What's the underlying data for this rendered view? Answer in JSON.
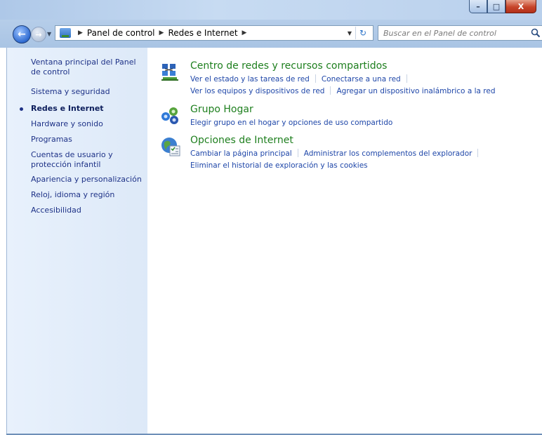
{
  "window": {
    "minimize": "–",
    "maximize": "□",
    "close": "X"
  },
  "address": {
    "crumbs": [
      "Panel de control",
      "Redes e Internet"
    ]
  },
  "search": {
    "placeholder": "Buscar en el Panel de control"
  },
  "sidebar": {
    "items": [
      {
        "label": "Ventana principal del Panel de control",
        "current": false
      },
      {
        "label": "Sistema y seguridad",
        "current": false
      },
      {
        "label": "Redes e Internet",
        "current": true
      },
      {
        "label": "Hardware y sonido",
        "current": false
      },
      {
        "label": "Programas",
        "current": false
      },
      {
        "label": "Cuentas de usuario y protección infantil",
        "current": false
      },
      {
        "label": "Apariencia y personalización",
        "current": false
      },
      {
        "label": "Reloj, idioma y región",
        "current": false
      },
      {
        "label": "Accesibilidad",
        "current": false
      }
    ]
  },
  "categories": [
    {
      "title": "Centro de redes y recursos compartidos",
      "icon": "network-center-icon",
      "links": [
        [
          "Ver el estado y las tareas de red",
          "Conectarse a una red"
        ],
        [
          "Ver los equipos y dispositivos de red",
          "Agregar un dispositivo inalámbrico a la red"
        ]
      ]
    },
    {
      "title": "Grupo Hogar",
      "icon": "homegroup-icon",
      "links": [
        [
          "Elegir grupo en el hogar y opciones de uso compartido"
        ]
      ]
    },
    {
      "title": "Opciones de Internet",
      "icon": "internet-options-icon",
      "links": [
        [
          "Cambiar la página principal",
          "Administrar los complementos del explorador"
        ],
        [
          "Eliminar el historial de exploración y las cookies"
        ]
      ]
    }
  ],
  "colors": {
    "link": "#1e46a8",
    "category_title": "#1e7f1e",
    "nav_text": "#1e3287"
  }
}
